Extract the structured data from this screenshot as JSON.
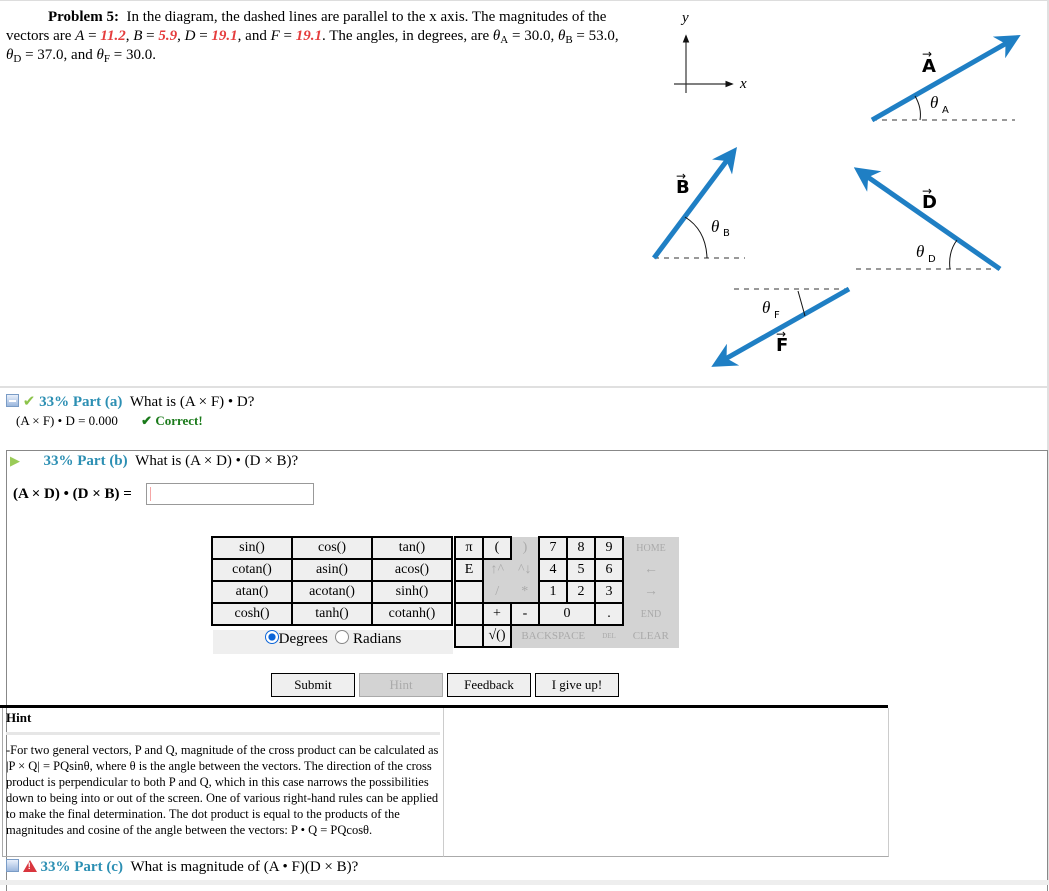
{
  "problem": {
    "label": "Problem 5:",
    "text1": "In the diagram, the dashed lines are parallel to the x axis. The magnitudes of the vectors are ",
    "A_sym": "A",
    "A_val": "11.2",
    "B_sym": "B",
    "B_val": "5.9",
    "D_sym": "D",
    "D_val": "19.1",
    "F_sym": "F",
    "F_val": "19.1",
    "angles_intro": "The angles, in degrees, are",
    "thetaA": "30.0",
    "thetaB": "53.0",
    "thetaD": "37.0",
    "thetaF": "30.0"
  },
  "diagram": {
    "axis_x": "x",
    "axis_y": "y",
    "vectors": [
      {
        "name": "A",
        "label": "A",
        "angle_label": "A"
      },
      {
        "name": "B",
        "label": "B",
        "angle_label": "B"
      },
      {
        "name": "D",
        "label": "D",
        "angle_label": "D"
      },
      {
        "name": "F",
        "label": "F",
        "angle_label": "F"
      }
    ],
    "vector_color": "#1f7fc4"
  },
  "part_a": {
    "percent": "33%",
    "label": "Part (a)",
    "question": "What is (A × F) • D?",
    "answer_expr": "(A × F) • D = 0.000",
    "status": "✔ Correct!"
  },
  "part_b": {
    "percent": "33%",
    "label": "Part (b)",
    "question": "What is (A × D) • (D × B)?",
    "input_label": "(A × D) • (D × B) =",
    "input_value": ""
  },
  "keypad": {
    "functions": [
      [
        "sin()",
        "cos()",
        "tan()"
      ],
      [
        "cotan()",
        "asin()",
        "acos()"
      ],
      [
        "atan()",
        "acotan()",
        "sinh()"
      ],
      [
        "cosh()",
        "tanh()",
        "cotanh()"
      ]
    ],
    "degrees": "Degrees",
    "radians": "Radians",
    "mode": "Degrees",
    "keys": [
      [
        "π",
        "(",
        ")",
        "7",
        "8",
        "9",
        "HOME"
      ],
      [
        "E",
        "↑^",
        "^↓",
        "4",
        "5",
        "6",
        "←"
      ],
      [
        "",
        "/",
        "*",
        "1",
        "2",
        "3",
        "→"
      ],
      [
        "",
        "+",
        "-",
        "0",
        ".",
        "END"
      ],
      [
        "",
        "√()",
        "BACKSPACE",
        "DEL",
        "CLEAR"
      ]
    ]
  },
  "buttons": {
    "submit": "Submit",
    "hint": "Hint",
    "feedback": "Feedback",
    "giveup": "I give up!"
  },
  "hint": {
    "title": "Hint",
    "text": "-For two general vectors, P and Q, magnitude of the cross product can be calculated as |P × Q| = PQsinθ, where θ is the angle between the vectors. The direction of the cross product is perpendicular to both P and Q, which in this case narrows the possibilities down to being into or out of the screen. One of various right-hand rules can be applied to make the final determination. The dot product is equal to the products of the magnitudes and cosine of the angle between the vectors: P • Q = PQcosθ."
  },
  "part_c": {
    "percent": "33%",
    "label": "Part (c)",
    "question": "What is magnitude of (A • F)(D × B)?"
  }
}
